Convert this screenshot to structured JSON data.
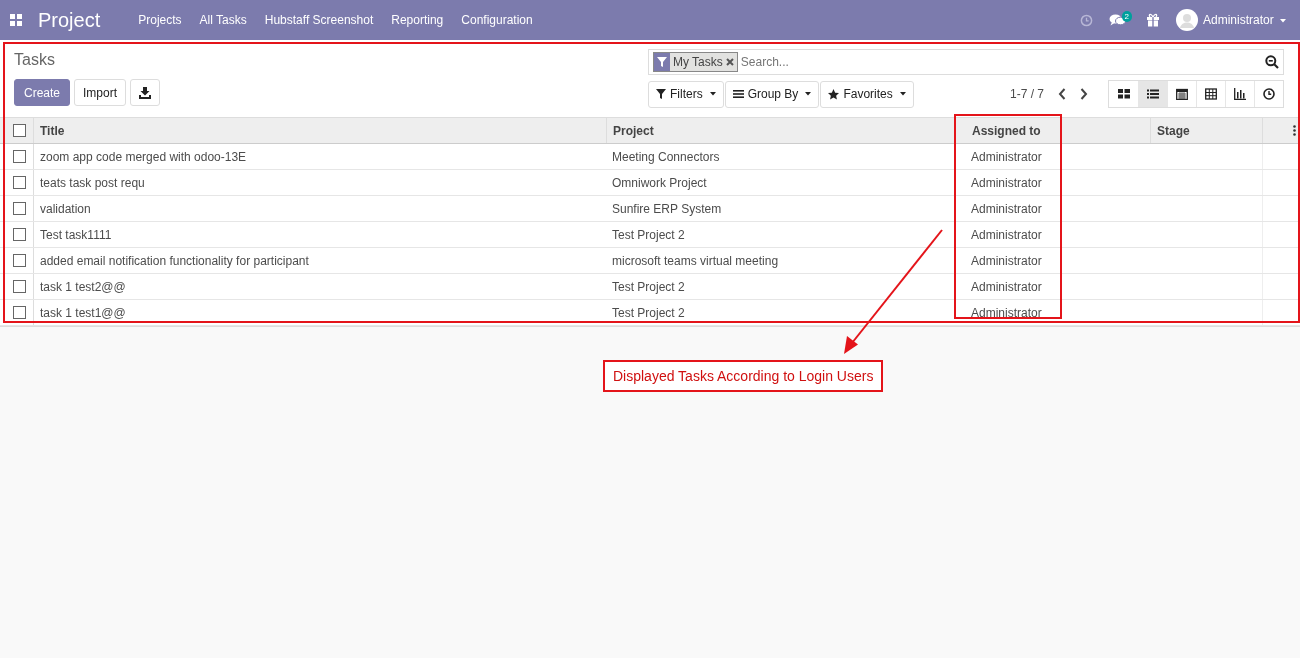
{
  "navbar": {
    "app_title": "Project",
    "menu": [
      {
        "label": "Projects"
      },
      {
        "label": "All Tasks"
      },
      {
        "label": "Hubstaff Screenshot"
      },
      {
        "label": "Reporting"
      },
      {
        "label": "Configuration"
      }
    ],
    "messages_badge": "2",
    "user": "Administrator"
  },
  "control_panel": {
    "title": "Tasks",
    "buttons": [
      {
        "label": "Create",
        "kind": "primary"
      },
      {
        "label": "Import",
        "kind": "secondary"
      },
      {
        "kind": "download"
      }
    ],
    "search": {
      "facet": "My Tasks",
      "placeholder": "Search..."
    },
    "filters": [
      {
        "label": "Filters",
        "kind": "filter"
      },
      {
        "label": "Group By",
        "kind": "group"
      },
      {
        "label": "Favorites",
        "kind": "star"
      }
    ],
    "pager": "1-7 / 7",
    "views": [
      {
        "kind": "kanban",
        "selected": false
      },
      {
        "kind": "list",
        "selected": true
      },
      {
        "kind": "calendar",
        "selected": false
      },
      {
        "kind": "pivot",
        "selected": false
      },
      {
        "kind": "graph",
        "selected": false
      },
      {
        "kind": "activity",
        "selected": false
      }
    ]
  },
  "table": {
    "select_all_checked": false,
    "columns": [
      "Title",
      "Project",
      "Assigned to",
      "Stage"
    ],
    "rows": [
      {
        "checked": false,
        "cells": [
          "zoom app code merged with odoo-13E",
          "Meeting Connectors",
          "Administrator",
          ""
        ]
      },
      {
        "checked": false,
        "cells": [
          "teats task post requ",
          "Omniwork Project",
          "Administrator",
          ""
        ]
      },
      {
        "checked": false,
        "cells": [
          "validation",
          "Sunfire ERP System",
          "Administrator",
          ""
        ]
      },
      {
        "checked": false,
        "cells": [
          "Test task1111",
          "Test Project 2",
          "Administrator",
          ""
        ]
      },
      {
        "checked": false,
        "cells": [
          "added email notification functionality for participant",
          "microsoft teams virtual meeting",
          "Administrator",
          ""
        ]
      },
      {
        "checked": false,
        "cells": [
          "task 1 test2@@",
          "Test Project 2",
          "Administrator",
          ""
        ]
      },
      {
        "checked": false,
        "cells": [
          "task 1 test1@@",
          "Test Project 2",
          "Administrator",
          ""
        ]
      }
    ]
  },
  "annotation": {
    "label": "Displayed Tasks According to Login Users"
  }
}
